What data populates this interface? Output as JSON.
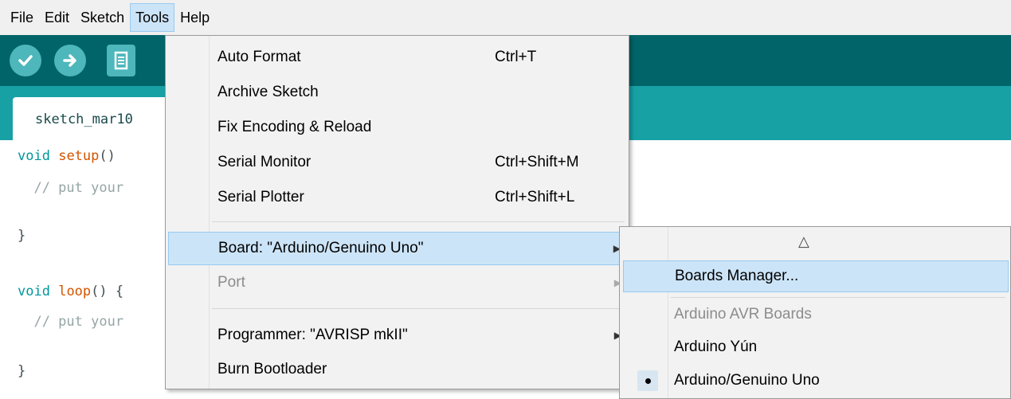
{
  "menubar": {
    "items": [
      {
        "label": "File"
      },
      {
        "label": "Edit"
      },
      {
        "label": "Sketch"
      },
      {
        "label": "Tools"
      },
      {
        "label": "Help"
      }
    ]
  },
  "toolbar": {
    "verify_icon": "check-icon",
    "upload_icon": "arrow-right-icon",
    "new_icon": "file-icon"
  },
  "tabs": [
    {
      "label": "sketch_mar10"
    }
  ],
  "editor": {
    "lines": [
      {
        "kw": "void",
        "fn": "setup",
        "rest": "()"
      },
      {
        "cm": "  // put your"
      },
      {
        "rest": "}"
      },
      {
        "kw": "void",
        "fn": "loop",
        "rest": "() {"
      },
      {
        "cm": "  // put your"
      },
      {
        "rest": "}"
      }
    ]
  },
  "tools_menu": {
    "items": [
      {
        "label": "Auto Format",
        "shortcut": "Ctrl+T"
      },
      {
        "label": "Archive Sketch",
        "shortcut": ""
      },
      {
        "label": "Fix Encoding & Reload",
        "shortcut": ""
      },
      {
        "label": "Serial Monitor",
        "shortcut": "Ctrl+Shift+M"
      },
      {
        "label": "Serial Plotter",
        "shortcut": "Ctrl+Shift+L"
      },
      {
        "label": "Board: \"Arduino/Genuino Uno\"",
        "shortcut": ""
      },
      {
        "label": "Port",
        "shortcut": ""
      },
      {
        "label": "Programmer: \"AVRISP mkII\"",
        "shortcut": ""
      },
      {
        "label": "Burn Bootloader",
        "shortcut": ""
      }
    ]
  },
  "board_submenu": {
    "scroll_up": "△",
    "items": [
      {
        "label": "Boards Manager..."
      },
      {
        "label": "Arduino AVR Boards"
      },
      {
        "label": "Arduino Yún"
      },
      {
        "label": "Arduino/Genuino Uno"
      }
    ]
  },
  "colors": {
    "toolbar": "#006468",
    "tabbar": "#17a1a5",
    "highlight": "#cce4f7"
  }
}
